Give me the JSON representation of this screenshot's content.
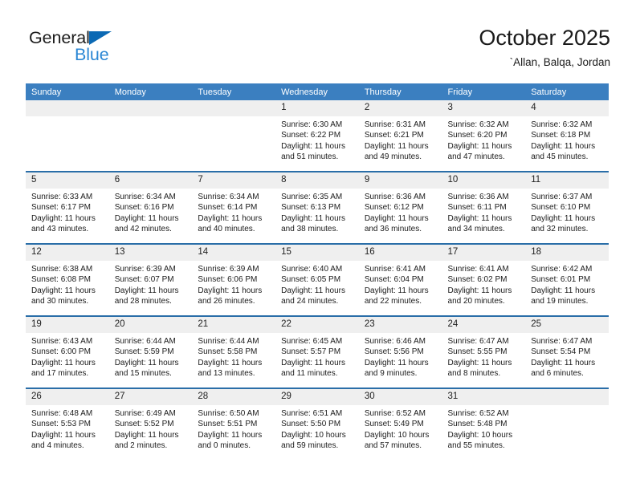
{
  "brand": {
    "name_top": "General",
    "name_bottom": "Blue",
    "triangle_color": "#0b69b4",
    "blue_color": "#2b87d4"
  },
  "header": {
    "title": "October 2025",
    "subtitle": "`Allan, Balqa, Jordan"
  },
  "theme": {
    "header_bg": "#3b7fc0",
    "row_divider": "#2a6ea8",
    "daynum_bg": "#efefef"
  },
  "weekdays": [
    "Sunday",
    "Monday",
    "Tuesday",
    "Wednesday",
    "Thursday",
    "Friday",
    "Saturday"
  ],
  "weeks": [
    [
      {
        "day": "",
        "blank": true,
        "lines": []
      },
      {
        "day": "",
        "blank": true,
        "lines": []
      },
      {
        "day": "",
        "blank": true,
        "lines": []
      },
      {
        "day": "1",
        "lines": [
          "Sunrise: 6:30 AM",
          "Sunset: 6:22 PM",
          "Daylight: 11 hours",
          "and 51 minutes."
        ]
      },
      {
        "day": "2",
        "lines": [
          "Sunrise: 6:31 AM",
          "Sunset: 6:21 PM",
          "Daylight: 11 hours",
          "and 49 minutes."
        ]
      },
      {
        "day": "3",
        "lines": [
          "Sunrise: 6:32 AM",
          "Sunset: 6:20 PM",
          "Daylight: 11 hours",
          "and 47 minutes."
        ]
      },
      {
        "day": "4",
        "lines": [
          "Sunrise: 6:32 AM",
          "Sunset: 6:18 PM",
          "Daylight: 11 hours",
          "and 45 minutes."
        ]
      }
    ],
    [
      {
        "day": "5",
        "lines": [
          "Sunrise: 6:33 AM",
          "Sunset: 6:17 PM",
          "Daylight: 11 hours",
          "and 43 minutes."
        ]
      },
      {
        "day": "6",
        "lines": [
          "Sunrise: 6:34 AM",
          "Sunset: 6:16 PM",
          "Daylight: 11 hours",
          "and 42 minutes."
        ]
      },
      {
        "day": "7",
        "lines": [
          "Sunrise: 6:34 AM",
          "Sunset: 6:14 PM",
          "Daylight: 11 hours",
          "and 40 minutes."
        ]
      },
      {
        "day": "8",
        "lines": [
          "Sunrise: 6:35 AM",
          "Sunset: 6:13 PM",
          "Daylight: 11 hours",
          "and 38 minutes."
        ]
      },
      {
        "day": "9",
        "lines": [
          "Sunrise: 6:36 AM",
          "Sunset: 6:12 PM",
          "Daylight: 11 hours",
          "and 36 minutes."
        ]
      },
      {
        "day": "10",
        "lines": [
          "Sunrise: 6:36 AM",
          "Sunset: 6:11 PM",
          "Daylight: 11 hours",
          "and 34 minutes."
        ]
      },
      {
        "day": "11",
        "lines": [
          "Sunrise: 6:37 AM",
          "Sunset: 6:10 PM",
          "Daylight: 11 hours",
          "and 32 minutes."
        ]
      }
    ],
    [
      {
        "day": "12",
        "lines": [
          "Sunrise: 6:38 AM",
          "Sunset: 6:08 PM",
          "Daylight: 11 hours",
          "and 30 minutes."
        ]
      },
      {
        "day": "13",
        "lines": [
          "Sunrise: 6:39 AM",
          "Sunset: 6:07 PM",
          "Daylight: 11 hours",
          "and 28 minutes."
        ]
      },
      {
        "day": "14",
        "lines": [
          "Sunrise: 6:39 AM",
          "Sunset: 6:06 PM",
          "Daylight: 11 hours",
          "and 26 minutes."
        ]
      },
      {
        "day": "15",
        "lines": [
          "Sunrise: 6:40 AM",
          "Sunset: 6:05 PM",
          "Daylight: 11 hours",
          "and 24 minutes."
        ]
      },
      {
        "day": "16",
        "lines": [
          "Sunrise: 6:41 AM",
          "Sunset: 6:04 PM",
          "Daylight: 11 hours",
          "and 22 minutes."
        ]
      },
      {
        "day": "17",
        "lines": [
          "Sunrise: 6:41 AM",
          "Sunset: 6:02 PM",
          "Daylight: 11 hours",
          "and 20 minutes."
        ]
      },
      {
        "day": "18",
        "lines": [
          "Sunrise: 6:42 AM",
          "Sunset: 6:01 PM",
          "Daylight: 11 hours",
          "and 19 minutes."
        ]
      }
    ],
    [
      {
        "day": "19",
        "lines": [
          "Sunrise: 6:43 AM",
          "Sunset: 6:00 PM",
          "Daylight: 11 hours",
          "and 17 minutes."
        ]
      },
      {
        "day": "20",
        "lines": [
          "Sunrise: 6:44 AM",
          "Sunset: 5:59 PM",
          "Daylight: 11 hours",
          "and 15 minutes."
        ]
      },
      {
        "day": "21",
        "lines": [
          "Sunrise: 6:44 AM",
          "Sunset: 5:58 PM",
          "Daylight: 11 hours",
          "and 13 minutes."
        ]
      },
      {
        "day": "22",
        "lines": [
          "Sunrise: 6:45 AM",
          "Sunset: 5:57 PM",
          "Daylight: 11 hours",
          "and 11 minutes."
        ]
      },
      {
        "day": "23",
        "lines": [
          "Sunrise: 6:46 AM",
          "Sunset: 5:56 PM",
          "Daylight: 11 hours",
          "and 9 minutes."
        ]
      },
      {
        "day": "24",
        "lines": [
          "Sunrise: 6:47 AM",
          "Sunset: 5:55 PM",
          "Daylight: 11 hours",
          "and 8 minutes."
        ]
      },
      {
        "day": "25",
        "lines": [
          "Sunrise: 6:47 AM",
          "Sunset: 5:54 PM",
          "Daylight: 11 hours",
          "and 6 minutes."
        ]
      }
    ],
    [
      {
        "day": "26",
        "lines": [
          "Sunrise: 6:48 AM",
          "Sunset: 5:53 PM",
          "Daylight: 11 hours",
          "and 4 minutes."
        ]
      },
      {
        "day": "27",
        "lines": [
          "Sunrise: 6:49 AM",
          "Sunset: 5:52 PM",
          "Daylight: 11 hours",
          "and 2 minutes."
        ]
      },
      {
        "day": "28",
        "lines": [
          "Sunrise: 6:50 AM",
          "Sunset: 5:51 PM",
          "Daylight: 11 hours",
          "and 0 minutes."
        ]
      },
      {
        "day": "29",
        "lines": [
          "Sunrise: 6:51 AM",
          "Sunset: 5:50 PM",
          "Daylight: 10 hours",
          "and 59 minutes."
        ]
      },
      {
        "day": "30",
        "lines": [
          "Sunrise: 6:52 AM",
          "Sunset: 5:49 PM",
          "Daylight: 10 hours",
          "and 57 minutes."
        ]
      },
      {
        "day": "31",
        "lines": [
          "Sunrise: 6:52 AM",
          "Sunset: 5:48 PM",
          "Daylight: 10 hours",
          "and 55 minutes."
        ]
      },
      {
        "day": "",
        "blank": true,
        "lines": []
      }
    ]
  ]
}
